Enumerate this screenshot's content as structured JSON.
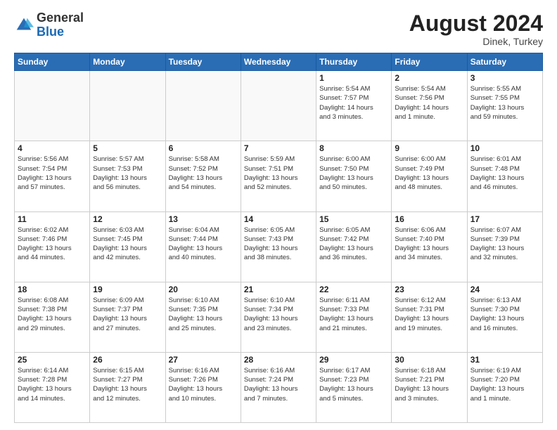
{
  "header": {
    "logo_general": "General",
    "logo_blue": "Blue",
    "month_year": "August 2024",
    "location": "Dinek, Turkey"
  },
  "days_of_week": [
    "Sunday",
    "Monday",
    "Tuesday",
    "Wednesday",
    "Thursday",
    "Friday",
    "Saturday"
  ],
  "weeks": [
    [
      {
        "day": "",
        "info": ""
      },
      {
        "day": "",
        "info": ""
      },
      {
        "day": "",
        "info": ""
      },
      {
        "day": "",
        "info": ""
      },
      {
        "day": "1",
        "info": "Sunrise: 5:54 AM\nSunset: 7:57 PM\nDaylight: 14 hours\nand 3 minutes."
      },
      {
        "day": "2",
        "info": "Sunrise: 5:54 AM\nSunset: 7:56 PM\nDaylight: 14 hours\nand 1 minute."
      },
      {
        "day": "3",
        "info": "Sunrise: 5:55 AM\nSunset: 7:55 PM\nDaylight: 13 hours\nand 59 minutes."
      }
    ],
    [
      {
        "day": "4",
        "info": "Sunrise: 5:56 AM\nSunset: 7:54 PM\nDaylight: 13 hours\nand 57 minutes."
      },
      {
        "day": "5",
        "info": "Sunrise: 5:57 AM\nSunset: 7:53 PM\nDaylight: 13 hours\nand 56 minutes."
      },
      {
        "day": "6",
        "info": "Sunrise: 5:58 AM\nSunset: 7:52 PM\nDaylight: 13 hours\nand 54 minutes."
      },
      {
        "day": "7",
        "info": "Sunrise: 5:59 AM\nSunset: 7:51 PM\nDaylight: 13 hours\nand 52 minutes."
      },
      {
        "day": "8",
        "info": "Sunrise: 6:00 AM\nSunset: 7:50 PM\nDaylight: 13 hours\nand 50 minutes."
      },
      {
        "day": "9",
        "info": "Sunrise: 6:00 AM\nSunset: 7:49 PM\nDaylight: 13 hours\nand 48 minutes."
      },
      {
        "day": "10",
        "info": "Sunrise: 6:01 AM\nSunset: 7:48 PM\nDaylight: 13 hours\nand 46 minutes."
      }
    ],
    [
      {
        "day": "11",
        "info": "Sunrise: 6:02 AM\nSunset: 7:46 PM\nDaylight: 13 hours\nand 44 minutes."
      },
      {
        "day": "12",
        "info": "Sunrise: 6:03 AM\nSunset: 7:45 PM\nDaylight: 13 hours\nand 42 minutes."
      },
      {
        "day": "13",
        "info": "Sunrise: 6:04 AM\nSunset: 7:44 PM\nDaylight: 13 hours\nand 40 minutes."
      },
      {
        "day": "14",
        "info": "Sunrise: 6:05 AM\nSunset: 7:43 PM\nDaylight: 13 hours\nand 38 minutes."
      },
      {
        "day": "15",
        "info": "Sunrise: 6:05 AM\nSunset: 7:42 PM\nDaylight: 13 hours\nand 36 minutes."
      },
      {
        "day": "16",
        "info": "Sunrise: 6:06 AM\nSunset: 7:40 PM\nDaylight: 13 hours\nand 34 minutes."
      },
      {
        "day": "17",
        "info": "Sunrise: 6:07 AM\nSunset: 7:39 PM\nDaylight: 13 hours\nand 32 minutes."
      }
    ],
    [
      {
        "day": "18",
        "info": "Sunrise: 6:08 AM\nSunset: 7:38 PM\nDaylight: 13 hours\nand 29 minutes."
      },
      {
        "day": "19",
        "info": "Sunrise: 6:09 AM\nSunset: 7:37 PM\nDaylight: 13 hours\nand 27 minutes."
      },
      {
        "day": "20",
        "info": "Sunrise: 6:10 AM\nSunset: 7:35 PM\nDaylight: 13 hours\nand 25 minutes."
      },
      {
        "day": "21",
        "info": "Sunrise: 6:10 AM\nSunset: 7:34 PM\nDaylight: 13 hours\nand 23 minutes."
      },
      {
        "day": "22",
        "info": "Sunrise: 6:11 AM\nSunset: 7:33 PM\nDaylight: 13 hours\nand 21 minutes."
      },
      {
        "day": "23",
        "info": "Sunrise: 6:12 AM\nSunset: 7:31 PM\nDaylight: 13 hours\nand 19 minutes."
      },
      {
        "day": "24",
        "info": "Sunrise: 6:13 AM\nSunset: 7:30 PM\nDaylight: 13 hours\nand 16 minutes."
      }
    ],
    [
      {
        "day": "25",
        "info": "Sunrise: 6:14 AM\nSunset: 7:28 PM\nDaylight: 13 hours\nand 14 minutes."
      },
      {
        "day": "26",
        "info": "Sunrise: 6:15 AM\nSunset: 7:27 PM\nDaylight: 13 hours\nand 12 minutes."
      },
      {
        "day": "27",
        "info": "Sunrise: 6:16 AM\nSunset: 7:26 PM\nDaylight: 13 hours\nand 10 minutes."
      },
      {
        "day": "28",
        "info": "Sunrise: 6:16 AM\nSunset: 7:24 PM\nDaylight: 13 hours\nand 7 minutes."
      },
      {
        "day": "29",
        "info": "Sunrise: 6:17 AM\nSunset: 7:23 PM\nDaylight: 13 hours\nand 5 minutes."
      },
      {
        "day": "30",
        "info": "Sunrise: 6:18 AM\nSunset: 7:21 PM\nDaylight: 13 hours\nand 3 minutes."
      },
      {
        "day": "31",
        "info": "Sunrise: 6:19 AM\nSunset: 7:20 PM\nDaylight: 13 hours\nand 1 minute."
      }
    ]
  ]
}
